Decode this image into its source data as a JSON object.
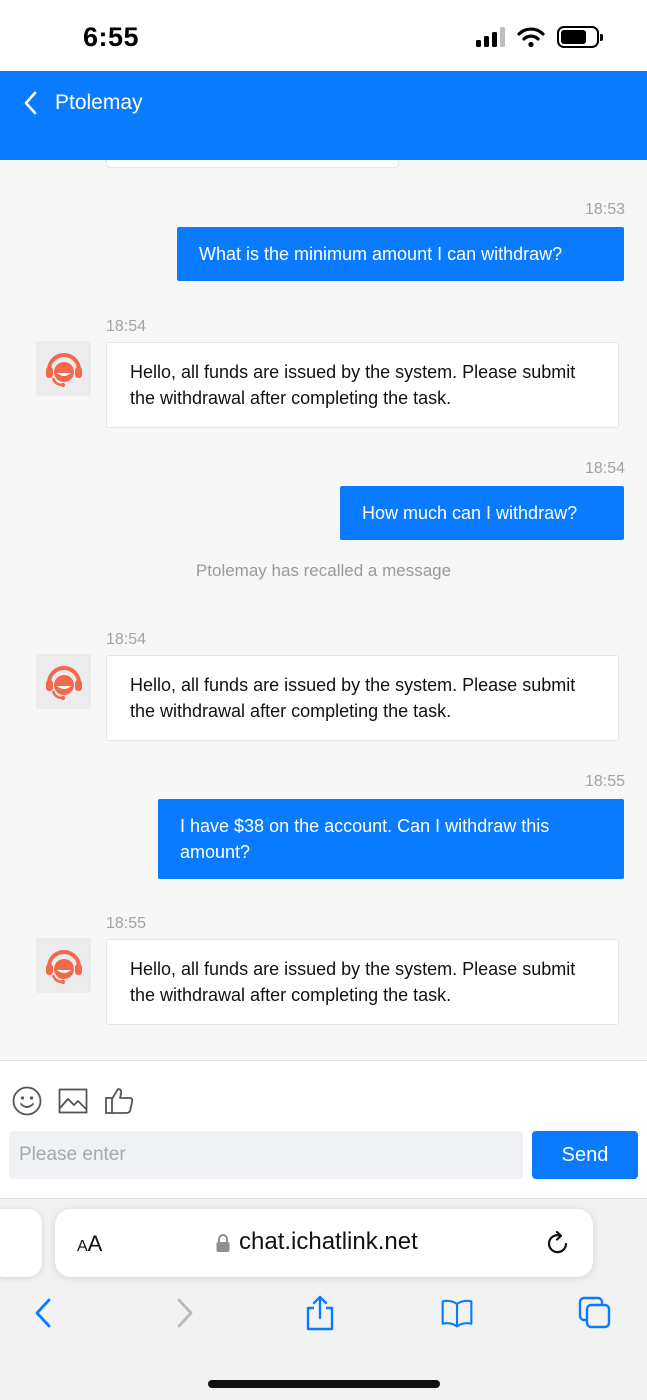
{
  "status_bar": {
    "time": "6:55"
  },
  "header": {
    "title": "Ptolemay"
  },
  "messages": {
    "m1_time": "18:53",
    "m1_text": "What is the minimum amount I can withdraw?",
    "m2_time": "18:54",
    "m2_text": "Hello, all funds are issued by the system. Please submit the withdrawal after completing the task.",
    "m3_time": "18:54",
    "m3_text": "How much can I withdraw?",
    "recall_notice": "Ptolemay has recalled a message",
    "m4_time": "18:54",
    "m4_text": "Hello, all funds are issued by the system. Please submit the withdrawal after completing the task.",
    "m5_time": "18:55",
    "m5_text": "I have $38 on the account. Can I withdraw this amount?",
    "m6_time": "18:55",
    "m6_text": "Hello, all funds are issued by the system. Please submit the withdrawal after completing the task."
  },
  "composer": {
    "placeholder": "Please enter",
    "send_label": "Send",
    "tools": [
      "emoji-icon",
      "image-icon",
      "thumbs-up-icon"
    ]
  },
  "browser": {
    "aa_small": "A",
    "aa_large": "A",
    "url": "chat.ichatlink.net"
  },
  "colors": {
    "accent": "#0a7bff",
    "agent_avatar": "#f26a4b",
    "background": "#f7f7f8"
  }
}
